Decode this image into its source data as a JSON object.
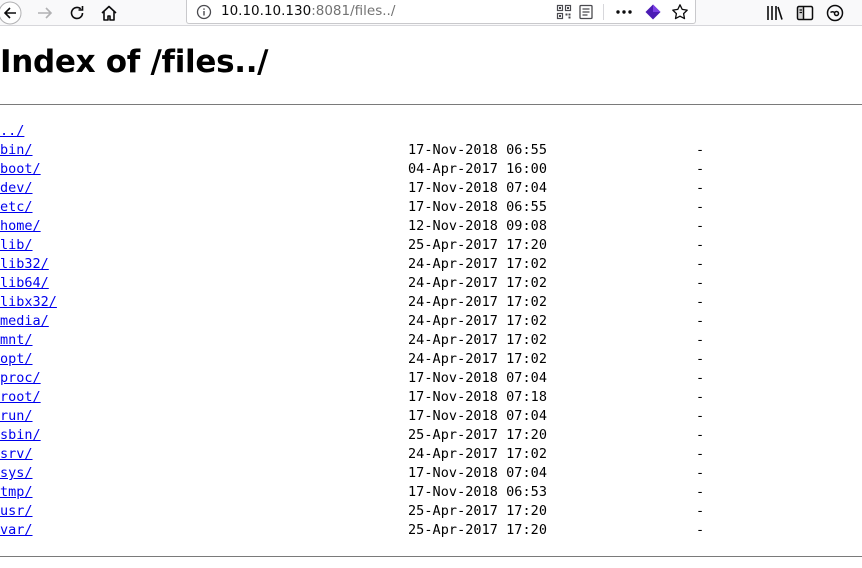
{
  "browser": {
    "url_host": "10.10.10.130",
    "url_rest": ":8081/files../",
    "icons": {
      "back": "back-arrow-icon",
      "forward": "forward-arrow-icon",
      "reload": "reload-icon",
      "home": "home-icon",
      "info": "info-icon",
      "qr": "qr-code-icon",
      "reader": "reader-view-icon",
      "more": "more-actions-icon",
      "extension": "extension-icon",
      "bookmark": "star-icon",
      "library": "library-icon",
      "sidebar": "sidebar-icon",
      "account": "account-icon"
    }
  },
  "page": {
    "title": "Index of /files../",
    "parent": "../",
    "entries": [
      {
        "name": "bin/",
        "date": "17-Nov-2018 06:55",
        "size": "-"
      },
      {
        "name": "boot/",
        "date": "04-Apr-2017 16:00",
        "size": "-"
      },
      {
        "name": "dev/",
        "date": "17-Nov-2018 07:04",
        "size": "-"
      },
      {
        "name": "etc/",
        "date": "17-Nov-2018 06:55",
        "size": "-"
      },
      {
        "name": "home/",
        "date": "12-Nov-2018 09:08",
        "size": "-"
      },
      {
        "name": "lib/",
        "date": "25-Apr-2017 17:20",
        "size": "-"
      },
      {
        "name": "lib32/",
        "date": "24-Apr-2017 17:02",
        "size": "-"
      },
      {
        "name": "lib64/",
        "date": "24-Apr-2017 17:02",
        "size": "-"
      },
      {
        "name": "libx32/",
        "date": "24-Apr-2017 17:02",
        "size": "-"
      },
      {
        "name": "media/",
        "date": "24-Apr-2017 17:02",
        "size": "-"
      },
      {
        "name": "mnt/",
        "date": "24-Apr-2017 17:02",
        "size": "-"
      },
      {
        "name": "opt/",
        "date": "24-Apr-2017 17:02",
        "size": "-"
      },
      {
        "name": "proc/",
        "date": "17-Nov-2018 07:04",
        "size": "-"
      },
      {
        "name": "root/",
        "date": "17-Nov-2018 07:18",
        "size": "-"
      },
      {
        "name": "run/",
        "date": "17-Nov-2018 07:04",
        "size": "-"
      },
      {
        "name": "sbin/",
        "date": "25-Apr-2017 17:20",
        "size": "-"
      },
      {
        "name": "srv/",
        "date": "24-Apr-2017 17:02",
        "size": "-"
      },
      {
        "name": "sys/",
        "date": "17-Nov-2018 07:04",
        "size": "-"
      },
      {
        "name": "tmp/",
        "date": "17-Nov-2018 06:53",
        "size": "-"
      },
      {
        "name": "usr/",
        "date": "25-Apr-2017 17:20",
        "size": "-"
      },
      {
        "name": "var/",
        "date": "25-Apr-2017 17:20",
        "size": "-"
      }
    ]
  },
  "colors": {
    "link": "#0000ee",
    "extension": "#4b1bb4"
  }
}
